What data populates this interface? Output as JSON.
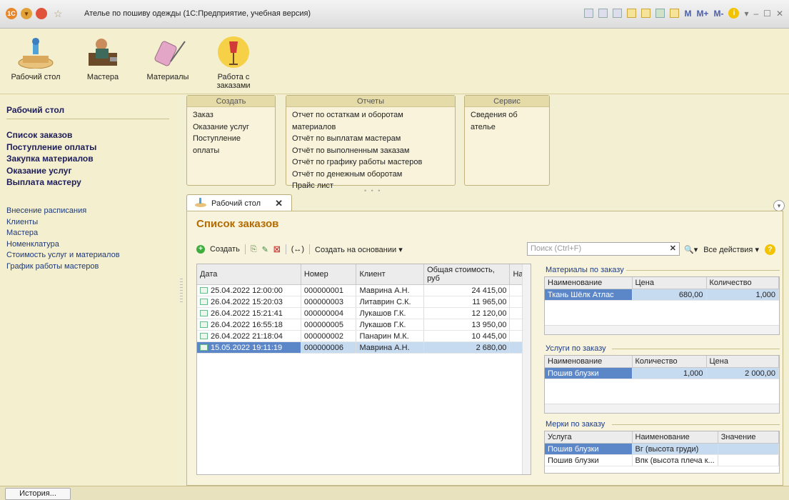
{
  "window": {
    "title": "Ателье по пошиву одежды  (1С:Предприятие, учебная версия)",
    "m_buttons": [
      "M",
      "M+",
      "M-"
    ]
  },
  "sections": [
    {
      "label": "Рабочий стол",
      "icon": "desk-icon"
    },
    {
      "label": "Мастера",
      "icon": "tailor-icon"
    },
    {
      "label": "Материалы",
      "icon": "thread-spool-icon"
    },
    {
      "label": "Работа с заказами",
      "icon": "mannequin-icon"
    }
  ],
  "sidebar": {
    "title": "Рабочий стол",
    "bold_items": [
      "Список заказов",
      "Поступление оплаты",
      "Закупка материалов",
      "Оказание услуг",
      "Выплата мастеру"
    ],
    "items": [
      "Внесение расписания",
      "Клиенты",
      "Мастера",
      "Номенклатура",
      "Стоимость услуг и материалов",
      "График работы мастеров"
    ]
  },
  "groups": {
    "create": {
      "title": "Создать",
      "items": [
        "Заказ",
        "Оказание услуг",
        "Поступление оплаты"
      ]
    },
    "reports": {
      "title": "Отчеты",
      "items": [
        "Отчет по остаткам и оборотам материалов",
        "Отчёт по выплатам мастерам",
        "Отчёт по выполненным заказам",
        "Отчёт по графику работы мастеров",
        "Отчёт по денежным оборотам",
        "Прайс лист"
      ]
    },
    "service": {
      "title": "Сервис",
      "items": [
        "Сведения об ателье"
      ]
    }
  },
  "tab": {
    "label": "Рабочий стол",
    "close": "✕"
  },
  "form": {
    "title": "Список заказов",
    "create_label": "Создать",
    "create_based_label": "Создать на основании ▾",
    "search_placeholder": "Поиск (Ctrl+F)",
    "all_actions_label": "Все действия ▾",
    "columns": [
      "Дата",
      "Номер",
      "Клиент",
      "Общая стоимость, руб",
      "Нач"
    ],
    "rows": [
      [
        "25.04.2022 12:00:00",
        "000000001",
        "Маврина А.Н.",
        "24 415,00"
      ],
      [
        "26.04.2022 15:20:03",
        "000000003",
        "Литаврин С.К.",
        "11 965,00"
      ],
      [
        "26.04.2022 15:21:41",
        "000000004",
        "Лукашов Г.К.",
        "12 120,00"
      ],
      [
        "26.04.2022 16:55:18",
        "000000005",
        "Лукашов Г.К.",
        "13 950,00"
      ],
      [
        "26.04.2022 21:18:04",
        "000000002",
        "Панарин М.К.",
        "10 445,00"
      ],
      [
        "15.05.2022 19:11:19",
        "000000006",
        "Маврина А.Н.",
        "2 680,00"
      ]
    ],
    "selected_row": 5
  },
  "materials": {
    "caption": "Материалы по заказу",
    "columns": [
      "Наименование",
      "Цена",
      "Количество"
    ],
    "rows": [
      [
        "Ткань Шёлк Атлас",
        "680,00",
        "1,000"
      ]
    ]
  },
  "services": {
    "caption": "Услуги по заказу",
    "columns": [
      "Наименование",
      "Количество",
      "Цена"
    ],
    "rows": [
      [
        "Пошив блузки",
        "1,000",
        "2 000,00"
      ]
    ]
  },
  "measures": {
    "caption": "Мерки по заказу",
    "columns": [
      "Услуга",
      "Наименование",
      "Значение"
    ],
    "rows": [
      [
        "Пошив блузки",
        "Вг (высота груди)",
        ""
      ],
      [
        "Пошив блузки",
        "Впк (высота плеча к...",
        ""
      ]
    ]
  },
  "statusbar": {
    "history_label": "История..."
  }
}
